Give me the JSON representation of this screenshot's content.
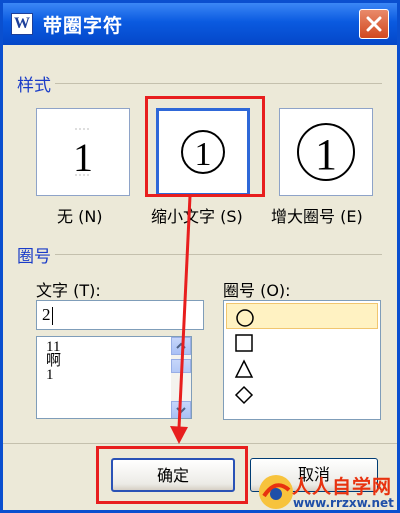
{
  "window": {
    "title": "带圈字符",
    "app_icon": "W",
    "close_icon": "close-x-icon"
  },
  "style_group": {
    "label": "样式",
    "options": [
      {
        "label": "无 (N)",
        "preview": "1",
        "selected": false
      },
      {
        "label": "缩小文字 (S)",
        "preview": "1",
        "selected": true
      },
      {
        "label": "增大圈号 (E)",
        "preview": "1",
        "selected": false
      }
    ]
  },
  "circle_group": {
    "label": "圈号",
    "text_label": "文字 (T):",
    "text_value": "2",
    "text_list": [
      "11",
      "啊",
      "1"
    ],
    "symbol_label": "圈号 (O):",
    "symbols": [
      "circle",
      "square",
      "triangle",
      "diamond"
    ],
    "selected_symbol": "circle"
  },
  "buttons": {
    "ok": "确定",
    "cancel": "取消"
  },
  "watermark": {
    "text": "人人自学网",
    "url": "www.rrzxw.net"
  },
  "colors": {
    "title_bar": "#0a5ae0",
    "group_label": "#1a3cc8",
    "annotation": "#e81e1e",
    "selection": "#2f68d8"
  }
}
